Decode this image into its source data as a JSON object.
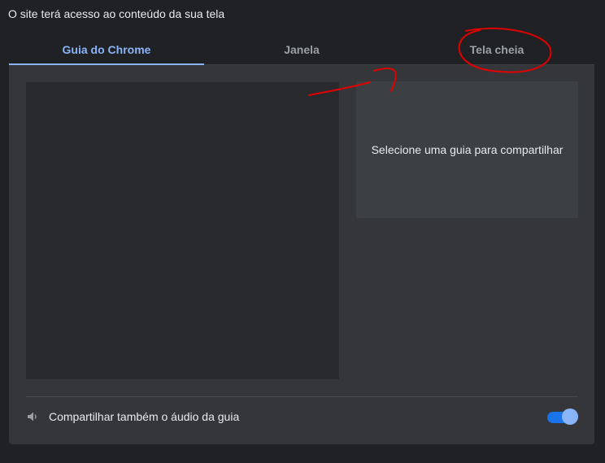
{
  "dialog": {
    "message": "O site terá acesso ao conteúdo da sua tela"
  },
  "tabs": [
    {
      "label": "Guia do Chrome",
      "active": true
    },
    {
      "label": "Janela",
      "active": false
    },
    {
      "label": "Tela cheia",
      "active": false
    }
  ],
  "preview": {
    "text": "Selecione uma guia para compartilhar"
  },
  "audio": {
    "label": "Compartilhar também o áudio da guia",
    "enabled": true,
    "icon": "speaker-icon"
  },
  "colors": {
    "background": "#202124",
    "panel": "#35363a",
    "accent": "#8ab4f8",
    "toggle_track": "#1a73e8",
    "annotation": "#e00000"
  }
}
